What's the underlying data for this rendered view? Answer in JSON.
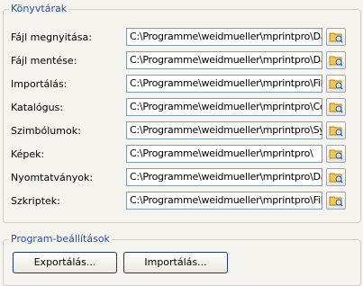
{
  "libraries": {
    "title": "Könyvtárak",
    "rows": [
      {
        "label": "Fájl megnyitása:",
        "path": "C:\\Programme\\weidmueller\\mprintpro\\Data\\"
      },
      {
        "label": "Fájl mentése:",
        "path": "C:\\Programme\\weidmueller\\mprintpro\\Data\\"
      },
      {
        "label": "Importálás:",
        "path": "C:\\Programme\\weidmueller\\mprintpro\\Filter\\"
      },
      {
        "label": "Katalógus:",
        "path": "C:\\Programme\\weidmueller\\mprintpro\\Configs"
      },
      {
        "label": "Szimbólumok:",
        "path": "C:\\Programme\\weidmueller\\mprintpro\\Symbol"
      },
      {
        "label": "Képek:",
        "path": "C:\\Programme\\weidmueller\\mprintpro\\"
      },
      {
        "label": "Nyomtatványok:",
        "path": "C:\\Programme\\weidmueller\\mprintpro\\Data\\"
      },
      {
        "label": "Szkriptek:",
        "path": "C:\\Programme\\weidmueller\\mprintpro\\Filter\\"
      }
    ],
    "browse_icon": "folder-browse-icon"
  },
  "program_settings": {
    "title": "Program-beállítások",
    "export_label": "Exportálás...",
    "import_label": "Importálás..."
  }
}
